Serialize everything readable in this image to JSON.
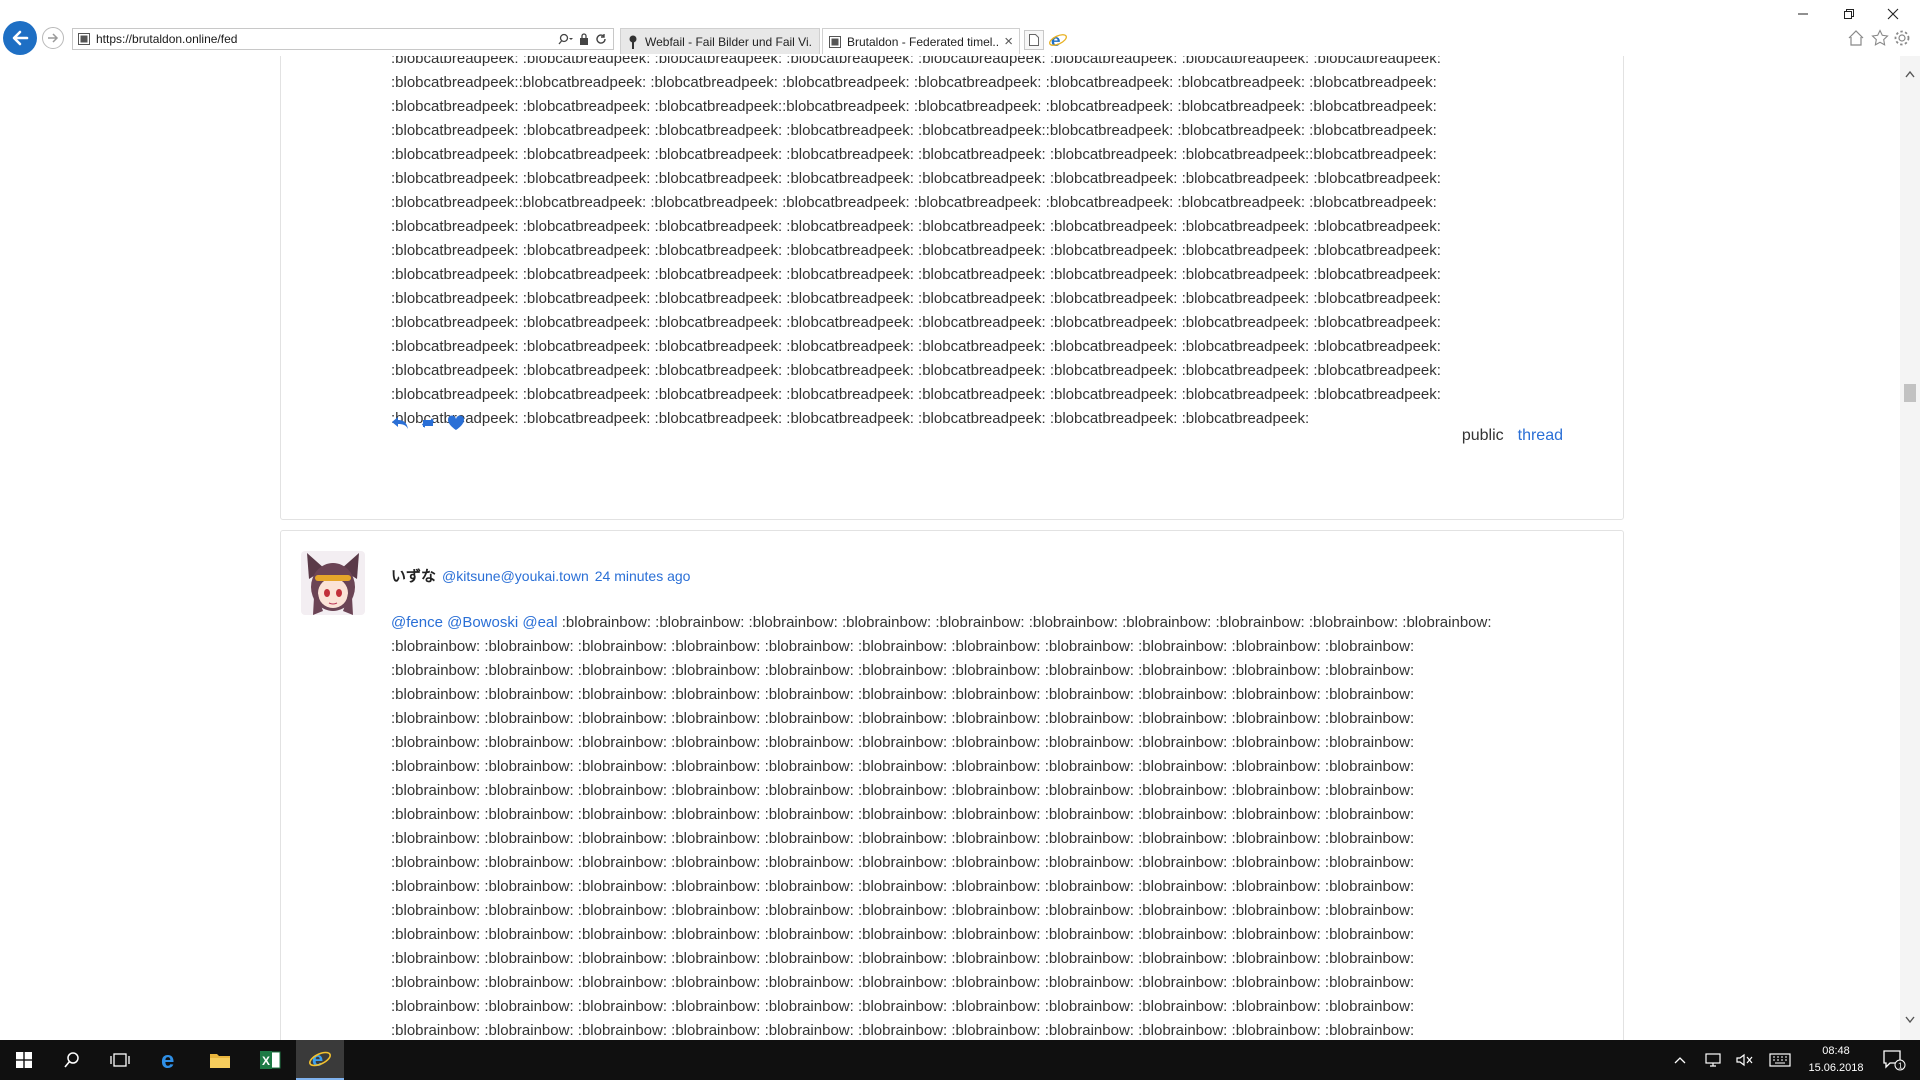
{
  "browser": {
    "url": "https://brutaldon.online/fed",
    "tabs": [
      {
        "label": "Webfail - Fail Bilder und Fail Vi..."
      },
      {
        "label": "Brutaldon - Federated timel...",
        "close": "×"
      }
    ]
  },
  "posts": [
    {
      "lines": [
        ":blobcatbreadpeek: :blobcatbreadpeek: :blobcatbreadpeek: :blobcatbreadpeek: :blobcatbreadpeek: :blobcatbreadpeek: :blobcatbreadpeek: :blobcatbreadpeek:",
        ":blobcatbreadpeek::blobcatbreadpeek: :blobcatbreadpeek: :blobcatbreadpeek: :blobcatbreadpeek: :blobcatbreadpeek: :blobcatbreadpeek: :blobcatbreadpeek:",
        ":blobcatbreadpeek: :blobcatbreadpeek: :blobcatbreadpeek::blobcatbreadpeek: :blobcatbreadpeek: :blobcatbreadpeek: :blobcatbreadpeek: :blobcatbreadpeek:",
        ":blobcatbreadpeek: :blobcatbreadpeek: :blobcatbreadpeek: :blobcatbreadpeek: :blobcatbreadpeek::blobcatbreadpeek: :blobcatbreadpeek: :blobcatbreadpeek:",
        ":blobcatbreadpeek: :blobcatbreadpeek: :blobcatbreadpeek: :blobcatbreadpeek: :blobcatbreadpeek: :blobcatbreadpeek: :blobcatbreadpeek::blobcatbreadpeek:",
        ":blobcatbreadpeek: :blobcatbreadpeek: :blobcatbreadpeek: :blobcatbreadpeek: :blobcatbreadpeek: :blobcatbreadpeek: :blobcatbreadpeek: :blobcatbreadpeek:",
        ":blobcatbreadpeek::blobcatbreadpeek: :blobcatbreadpeek: :blobcatbreadpeek: :blobcatbreadpeek: :blobcatbreadpeek: :blobcatbreadpeek: :blobcatbreadpeek:",
        ":blobcatbreadpeek: :blobcatbreadpeek: :blobcatbreadpeek: :blobcatbreadpeek: :blobcatbreadpeek: :blobcatbreadpeek: :blobcatbreadpeek: :blobcatbreadpeek:",
        ":blobcatbreadpeek: :blobcatbreadpeek: :blobcatbreadpeek: :blobcatbreadpeek: :blobcatbreadpeek: :blobcatbreadpeek: :blobcatbreadpeek: :blobcatbreadpeek:",
        ":blobcatbreadpeek: :blobcatbreadpeek: :blobcatbreadpeek: :blobcatbreadpeek: :blobcatbreadpeek: :blobcatbreadpeek: :blobcatbreadpeek: :blobcatbreadpeek:",
        ":blobcatbreadpeek: :blobcatbreadpeek: :blobcatbreadpeek: :blobcatbreadpeek: :blobcatbreadpeek: :blobcatbreadpeek: :blobcatbreadpeek: :blobcatbreadpeek:",
        ":blobcatbreadpeek: :blobcatbreadpeek: :blobcatbreadpeek: :blobcatbreadpeek: :blobcatbreadpeek: :blobcatbreadpeek: :blobcatbreadpeek: :blobcatbreadpeek:",
        ":blobcatbreadpeek: :blobcatbreadpeek: :blobcatbreadpeek: :blobcatbreadpeek: :blobcatbreadpeek: :blobcatbreadpeek: :blobcatbreadpeek: :blobcatbreadpeek:",
        ":blobcatbreadpeek: :blobcatbreadpeek: :blobcatbreadpeek: :blobcatbreadpeek: :blobcatbreadpeek: :blobcatbreadpeek: :blobcatbreadpeek: :blobcatbreadpeek:",
        ":blobcatbreadpeek: :blobcatbreadpeek: :blobcatbreadpeek: :blobcatbreadpeek: :blobcatbreadpeek: :blobcatbreadpeek: :blobcatbreadpeek: :blobcatbreadpeek:",
        ":blobcatbreadpeek: :blobcatbreadpeek: :blobcatbreadpeek: :blobcatbreadpeek: :blobcatbreadpeek: :blobcatbreadpeek: :blobcatbreadpeek:"
      ],
      "visibility": "public",
      "thread_link": "thread"
    },
    {
      "display_name": "いずな",
      "handle": "@kitsune@youkai.town",
      "time_ago": "24 minutes ago",
      "mentions": "@fence @Bowoski @eal",
      "first_line_rest": ":blobrainbow: :blobrainbow: :blobrainbow: :blobrainbow: :blobrainbow: :blobrainbow: :blobrainbow: :blobrainbow: :blobrainbow: :blobrainbow:",
      "lines": [
        ":blobrainbow: :blobrainbow: :blobrainbow: :blobrainbow: :blobrainbow: :blobrainbow: :blobrainbow: :blobrainbow: :blobrainbow: :blobrainbow: :blobrainbow:",
        ":blobrainbow: :blobrainbow: :blobrainbow: :blobrainbow: :blobrainbow: :blobrainbow: :blobrainbow: :blobrainbow: :blobrainbow: :blobrainbow: :blobrainbow:",
        ":blobrainbow: :blobrainbow: :blobrainbow: :blobrainbow: :blobrainbow: :blobrainbow: :blobrainbow: :blobrainbow: :blobrainbow: :blobrainbow: :blobrainbow:",
        ":blobrainbow: :blobrainbow: :blobrainbow: :blobrainbow: :blobrainbow: :blobrainbow: :blobrainbow: :blobrainbow: :blobrainbow: :blobrainbow: :blobrainbow:",
        ":blobrainbow: :blobrainbow: :blobrainbow: :blobrainbow: :blobrainbow: :blobrainbow: :blobrainbow: :blobrainbow: :blobrainbow: :blobrainbow: :blobrainbow:",
        ":blobrainbow: :blobrainbow: :blobrainbow: :blobrainbow: :blobrainbow: :blobrainbow: :blobrainbow: :blobrainbow: :blobrainbow: :blobrainbow: :blobrainbow:",
        ":blobrainbow: :blobrainbow: :blobrainbow: :blobrainbow: :blobrainbow: :blobrainbow: :blobrainbow: :blobrainbow: :blobrainbow: :blobrainbow: :blobrainbow:",
        ":blobrainbow: :blobrainbow: :blobrainbow: :blobrainbow: :blobrainbow: :blobrainbow: :blobrainbow: :blobrainbow: :blobrainbow: :blobrainbow: :blobrainbow:",
        ":blobrainbow: :blobrainbow: :blobrainbow: :blobrainbow: :blobrainbow: :blobrainbow: :blobrainbow: :blobrainbow: :blobrainbow: :blobrainbow: :blobrainbow:",
        ":blobrainbow: :blobrainbow: :blobrainbow: :blobrainbow: :blobrainbow: :blobrainbow: :blobrainbow: :blobrainbow: :blobrainbow: :blobrainbow: :blobrainbow:",
        ":blobrainbow: :blobrainbow: :blobrainbow: :blobrainbow: :blobrainbow: :blobrainbow: :blobrainbow: :blobrainbow: :blobrainbow: :blobrainbow: :blobrainbow:",
        ":blobrainbow: :blobrainbow: :blobrainbow: :blobrainbow: :blobrainbow: :blobrainbow: :blobrainbow: :blobrainbow: :blobrainbow: :blobrainbow: :blobrainbow:",
        ":blobrainbow: :blobrainbow: :blobrainbow: :blobrainbow: :blobrainbow: :blobrainbow: :blobrainbow: :blobrainbow: :blobrainbow: :blobrainbow: :blobrainbow:",
        ":blobrainbow: :blobrainbow: :blobrainbow: :blobrainbow: :blobrainbow: :blobrainbow: :blobrainbow: :blobrainbow: :blobrainbow: :blobrainbow: :blobrainbow:",
        ":blobrainbow: :blobrainbow: :blobrainbow: :blobrainbow: :blobrainbow: :blobrainbow: :blobrainbow: :blobrainbow: :blobrainbow: :blobrainbow: :blobrainbow:",
        ":blobrainbow: :blobrainbow: :blobrainbow: :blobrainbow: :blobrainbow: :blobrainbow: :blobrainbow: :blobrainbow: :blobrainbow: :blobrainbow: :blobrainbow:",
        ":blobrainbow: :blobrainbow: :blobrainbow: :blobrainbow: :blobrainbow: :blobrainbow: :blobrainbow: :blobrainbow: :blobrainbow: :blobrainbow: :blobrainbow:"
      ]
    }
  ],
  "taskbar": {
    "clock_time": "08:48",
    "clock_date": "15.06.2018",
    "notification_count": "1"
  },
  "colors": {
    "link": "#2a6fd6",
    "back_button": "#1e6fc4",
    "taskbar": "#101010"
  },
  "icons": [
    "back-arrow-icon",
    "forward-arrow-icon",
    "search-icon",
    "lock-icon",
    "refresh-icon",
    "home-icon",
    "star-icon",
    "gear-icon",
    "reply-icon",
    "boost-icon",
    "heart-icon",
    "windows-start-icon",
    "edge-icon",
    "explorer-icon",
    "excel-icon",
    "ie-icon"
  ]
}
